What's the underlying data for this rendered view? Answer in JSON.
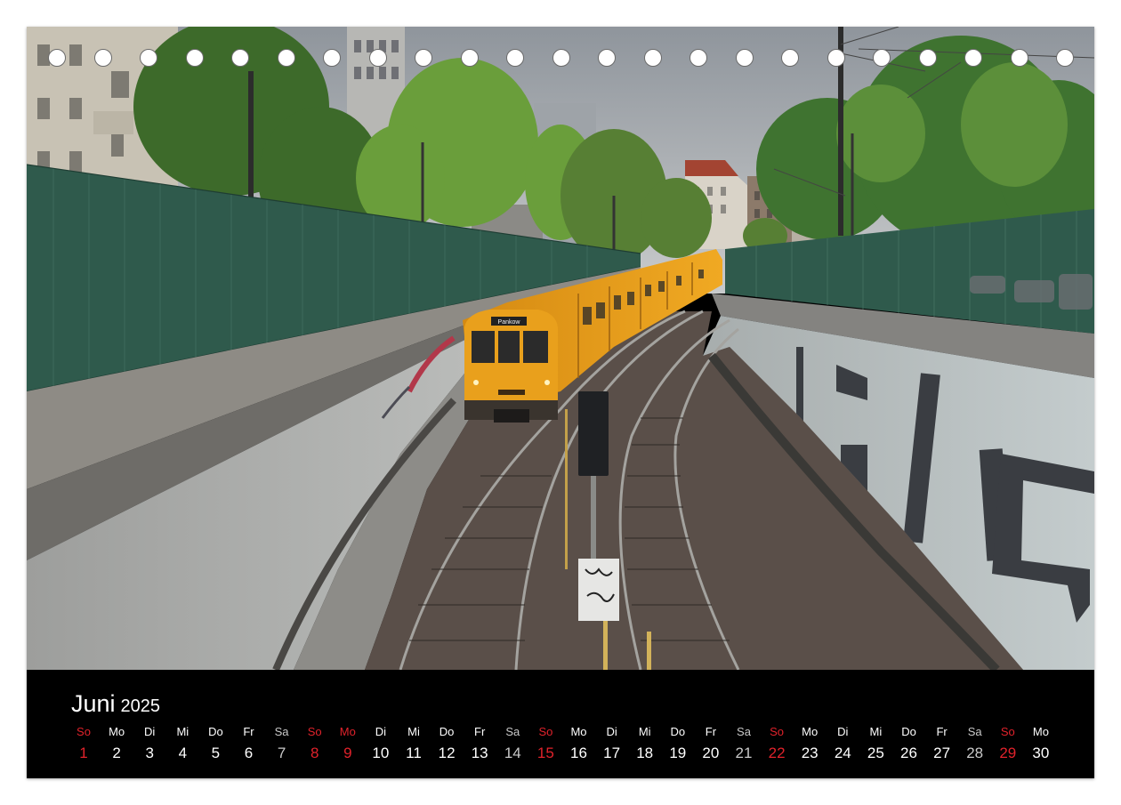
{
  "calendar": {
    "month": "Juni",
    "year": "2025",
    "days": [
      {
        "dow": "So",
        "num": "1",
        "kind": "red"
      },
      {
        "dow": "Mo",
        "num": "2",
        "kind": "normal"
      },
      {
        "dow": "Di",
        "num": "3",
        "kind": "normal"
      },
      {
        "dow": "Mi",
        "num": "4",
        "kind": "normal"
      },
      {
        "dow": "Do",
        "num": "5",
        "kind": "normal"
      },
      {
        "dow": "Fr",
        "num": "6",
        "kind": "normal"
      },
      {
        "dow": "Sa",
        "num": "7",
        "kind": "grey"
      },
      {
        "dow": "So",
        "num": "8",
        "kind": "red"
      },
      {
        "dow": "Mo",
        "num": "9",
        "kind": "red"
      },
      {
        "dow": "Di",
        "num": "10",
        "kind": "normal"
      },
      {
        "dow": "Mi",
        "num": "11",
        "kind": "normal"
      },
      {
        "dow": "Do",
        "num": "12",
        "kind": "normal"
      },
      {
        "dow": "Fr",
        "num": "13",
        "kind": "normal"
      },
      {
        "dow": "Sa",
        "num": "14",
        "kind": "grey"
      },
      {
        "dow": "So",
        "num": "15",
        "kind": "red"
      },
      {
        "dow": "Mo",
        "num": "16",
        "kind": "normal"
      },
      {
        "dow": "Di",
        "num": "17",
        "kind": "normal"
      },
      {
        "dow": "Mi",
        "num": "18",
        "kind": "normal"
      },
      {
        "dow": "Do",
        "num": "19",
        "kind": "normal"
      },
      {
        "dow": "Fr",
        "num": "20",
        "kind": "normal"
      },
      {
        "dow": "Sa",
        "num": "21",
        "kind": "grey"
      },
      {
        "dow": "So",
        "num": "22",
        "kind": "red"
      },
      {
        "dow": "Mo",
        "num": "23",
        "kind": "normal"
      },
      {
        "dow": "Di",
        "num": "24",
        "kind": "normal"
      },
      {
        "dow": "Mi",
        "num": "25",
        "kind": "normal"
      },
      {
        "dow": "Do",
        "num": "26",
        "kind": "normal"
      },
      {
        "dow": "Fr",
        "num": "27",
        "kind": "normal"
      },
      {
        "dow": "Sa",
        "num": "28",
        "kind": "grey"
      },
      {
        "dow": "So",
        "num": "29",
        "kind": "red"
      },
      {
        "dow": "Mo",
        "num": "30",
        "kind": "normal"
      }
    ]
  },
  "photo": {
    "train_sign": "Pankow"
  },
  "colors": {
    "sunday_red": "#e0222b",
    "saturday_grey": "#c9c9c9",
    "train_yellow": "#e9a01c",
    "railing_green": "#2f5a4c",
    "calendar_bg": "#000000"
  }
}
